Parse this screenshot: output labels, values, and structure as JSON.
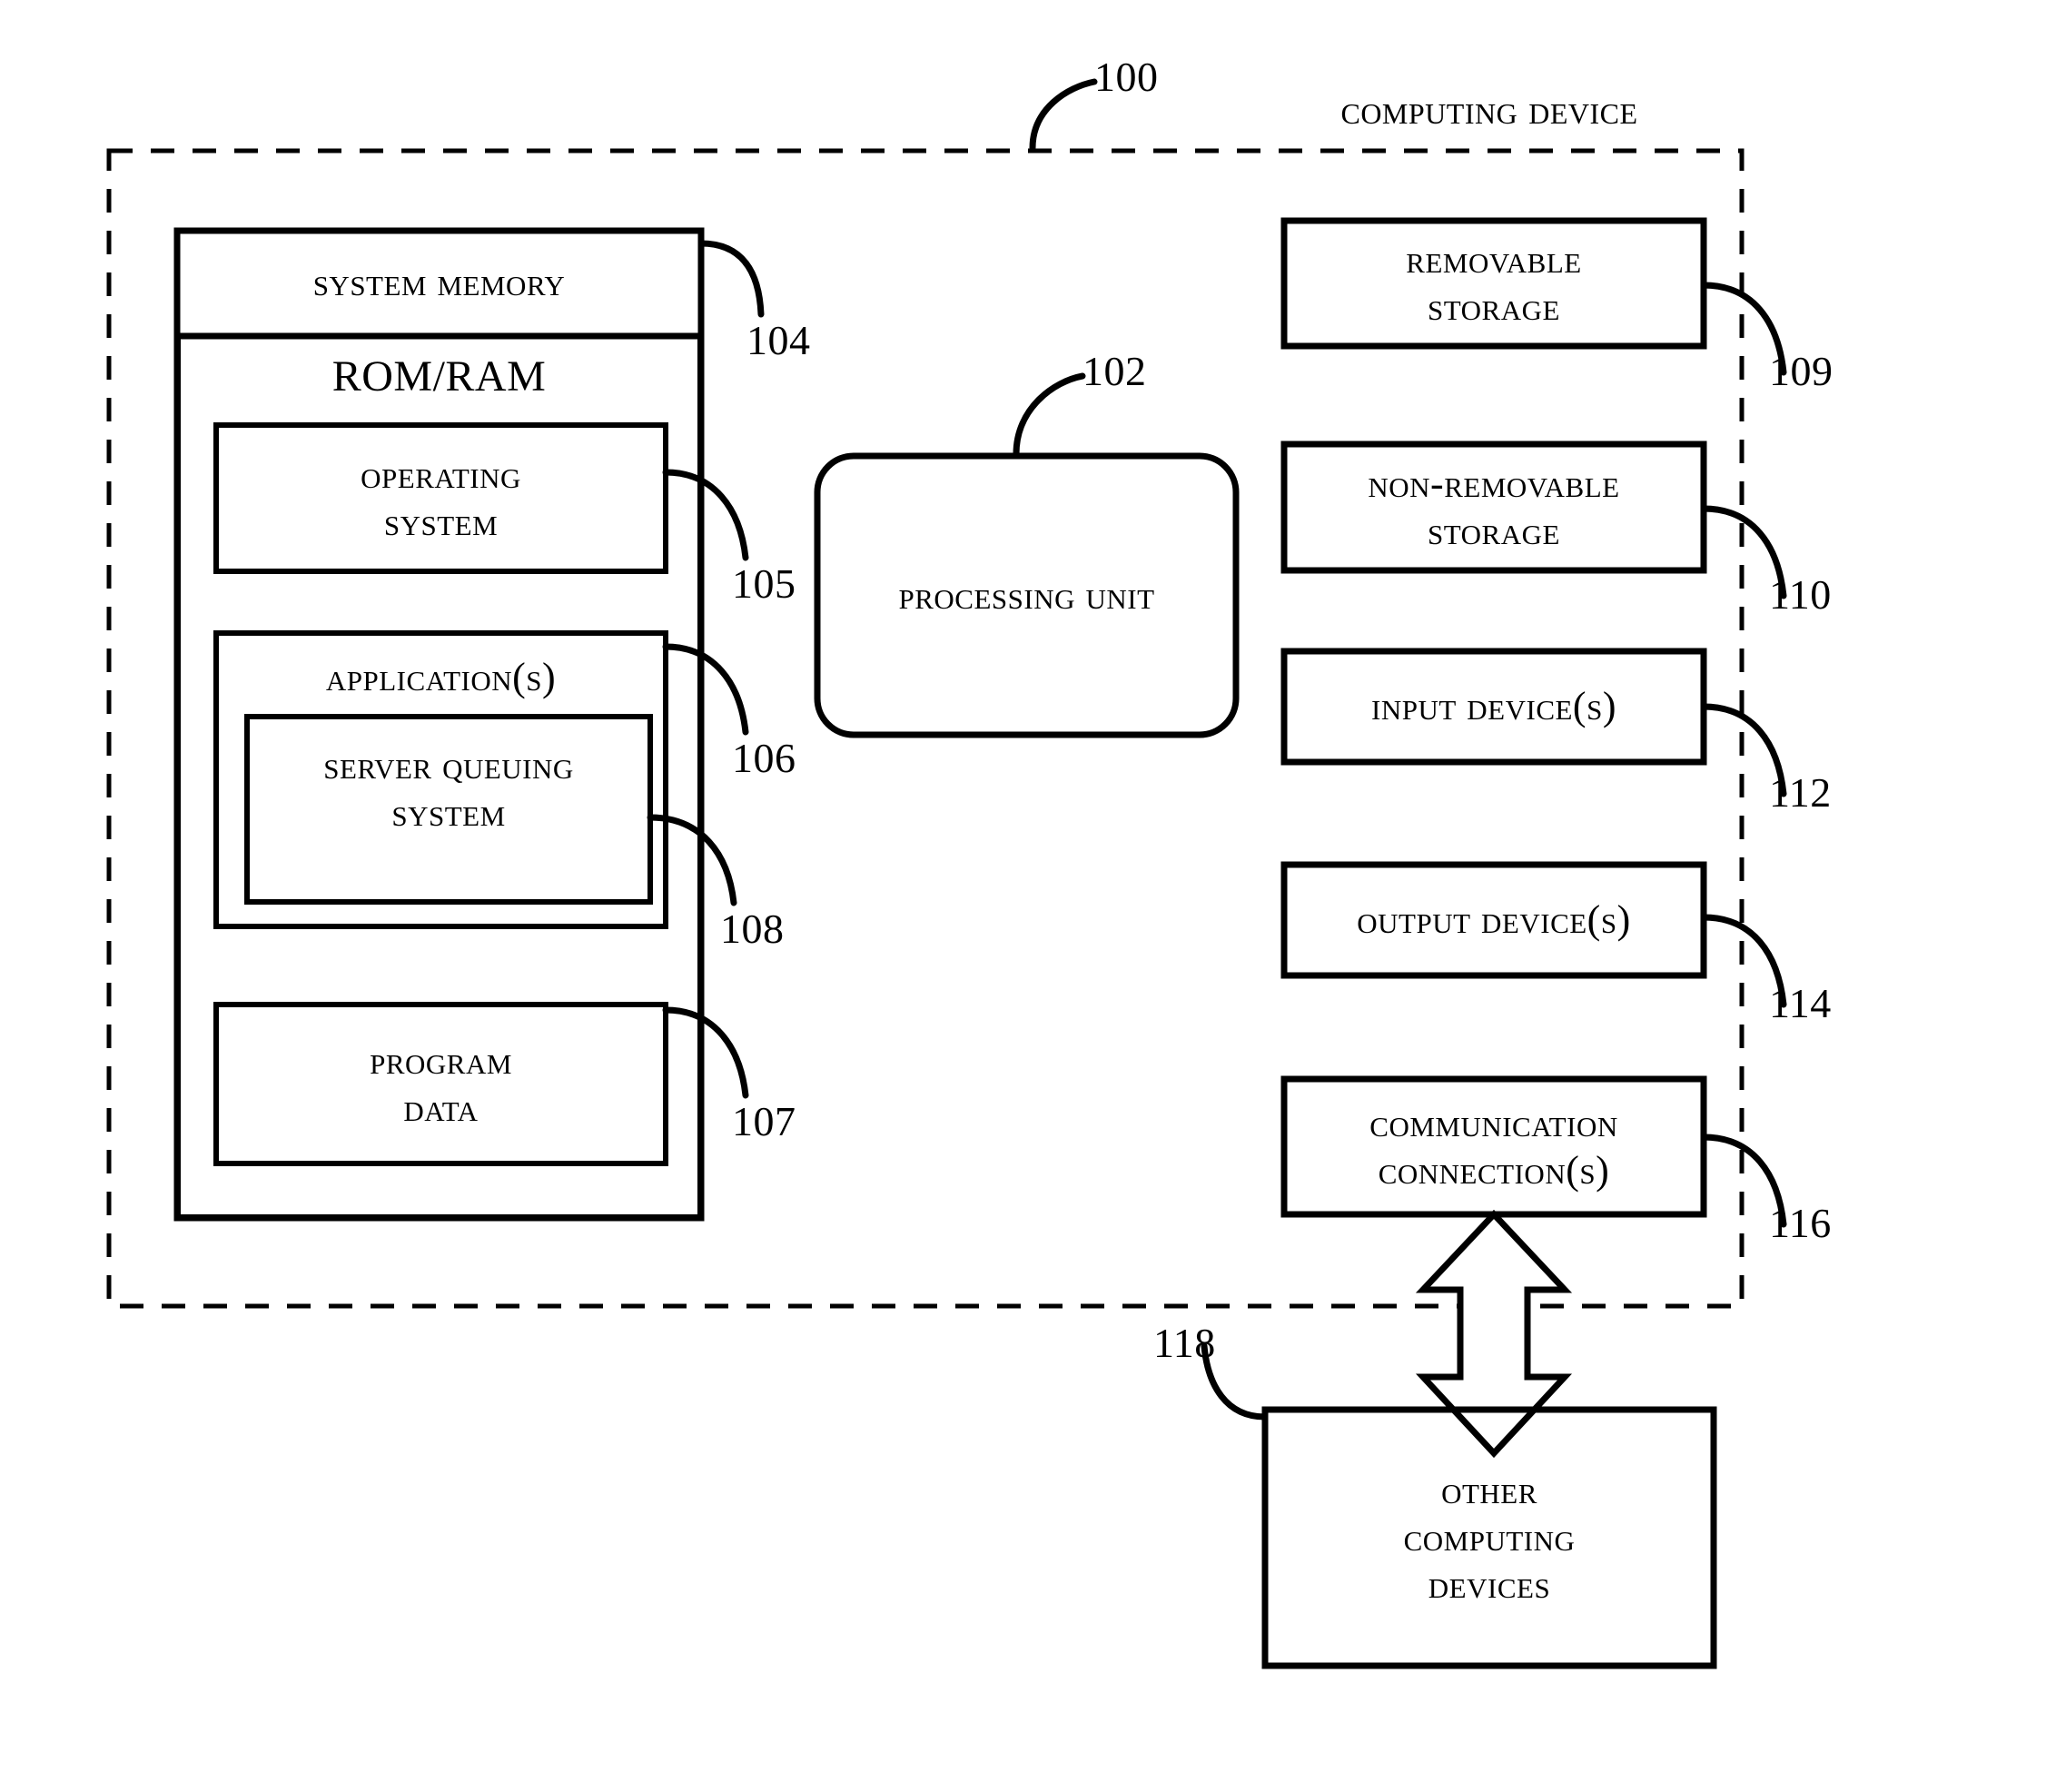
{
  "figure": {
    "title": "Computing Device",
    "figure_ref": "100",
    "style": "patent-block-diagram"
  },
  "system_memory": {
    "header": "System Memory",
    "header_ref": "104",
    "rom_ram": "ROM/RAM",
    "blocks": [
      {
        "label": "Operating\nSystem",
        "ref": "105",
        "name": "operating-system"
      },
      {
        "label": "Application(s)",
        "ref": "106",
        "name": "applications"
      },
      {
        "label": "Server Queuing\nSystem",
        "ref": "108",
        "name": "server-queuing-system"
      },
      {
        "label": "Program\nData",
        "ref": "107",
        "name": "program-data"
      }
    ]
  },
  "processing_unit": {
    "label": "Processing Unit",
    "ref": "102"
  },
  "peripherals": [
    {
      "label": "Removable\nStorage",
      "ref": "109",
      "name": "removable-storage"
    },
    {
      "label": "Non-Removable\nStorage",
      "ref": "110",
      "name": "non-removable-storage"
    },
    {
      "label": "Input Device(s)",
      "ref": "112",
      "name": "input-devices"
    },
    {
      "label": "Output Device(s)",
      "ref": "114",
      "name": "output-devices"
    },
    {
      "label": "Communication\nConnection(s)",
      "ref": "116",
      "name": "communication-connections"
    }
  ],
  "external": {
    "label": "Other\nComputing\nDevices",
    "ref": "118"
  },
  "colors": {
    "ink": "#000000",
    "paper": "#ffffff"
  }
}
